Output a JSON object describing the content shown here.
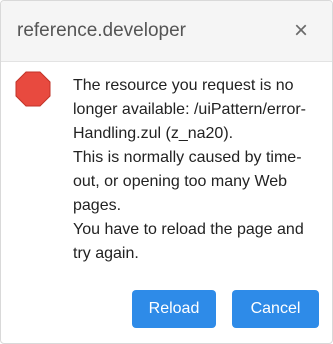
{
  "dialog": {
    "title": "reference.developer",
    "close_symbol": "×",
    "icon": "error-stop-icon",
    "colors": {
      "header_bg": "#f5f5f5",
      "icon_red": "#e84a3f",
      "button_blue": "#2e8be8"
    },
    "message": {
      "line1": "The resource you request is no longer available: /uiPattern/error-Handling.zul (z_na20).",
      "line2": "This is normally caused by time-out, or opening too many Web pages.",
      "line3": "You have to reload the page and try again."
    },
    "buttons": {
      "reload": "Reload",
      "cancel": "Cancel"
    }
  }
}
